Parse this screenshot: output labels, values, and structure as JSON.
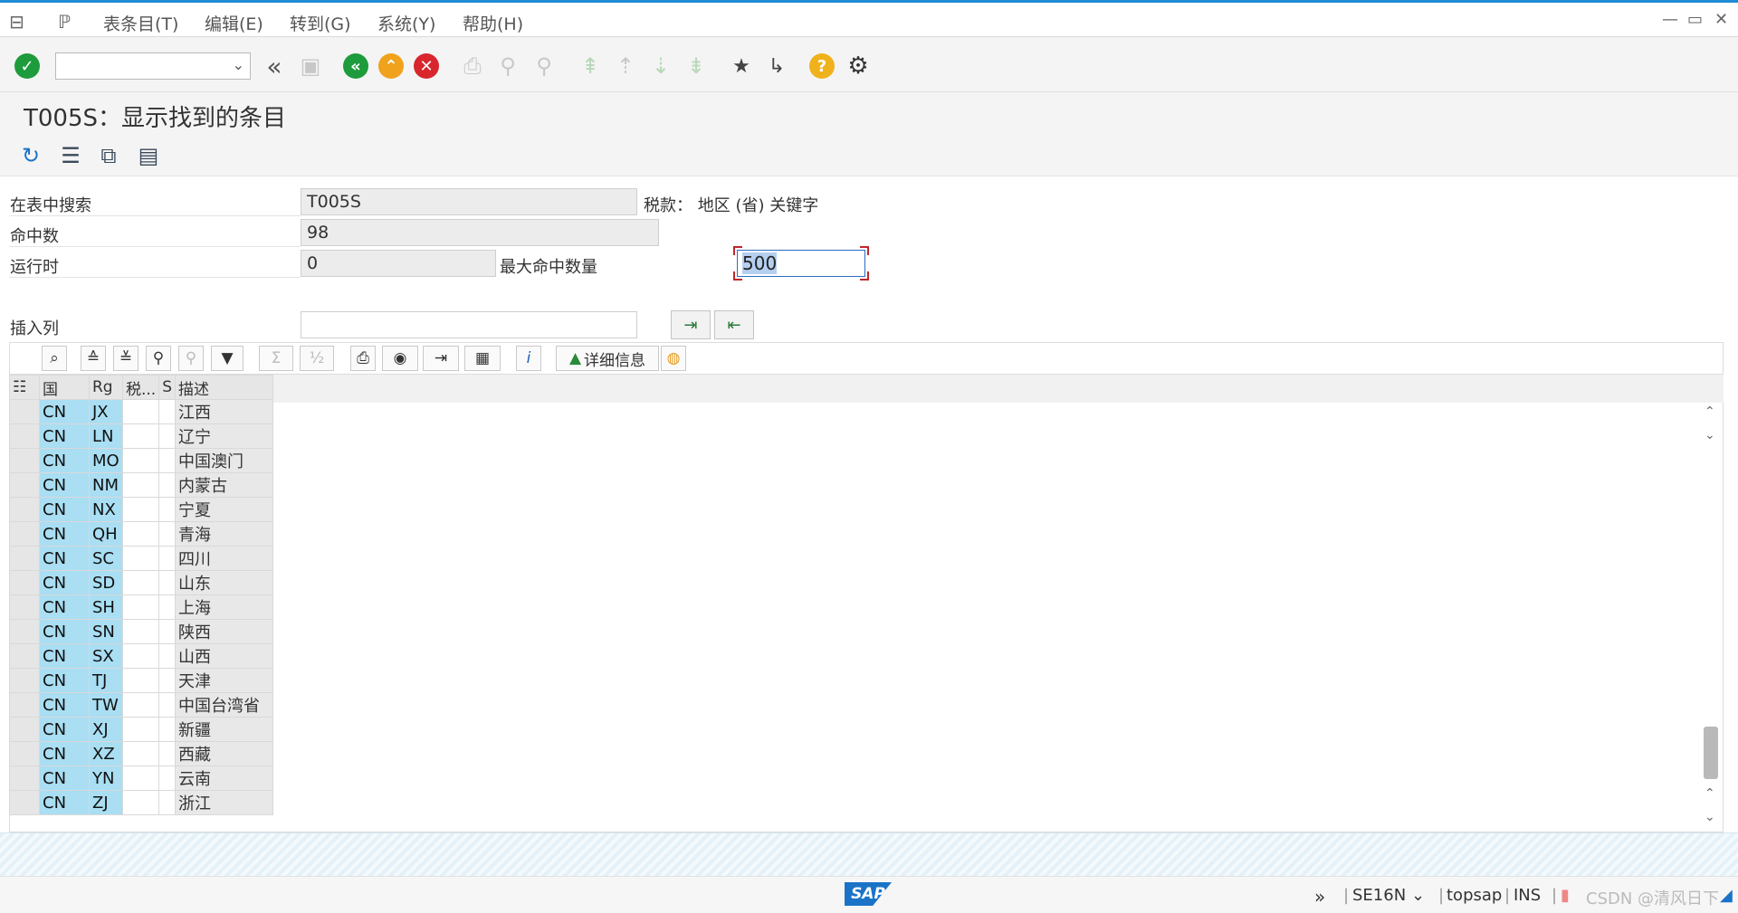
{
  "menu": [
    "表条目(T)",
    "编辑(E)",
    "转到(G)",
    "系统(Y)",
    "帮助(H)"
  ],
  "window_controls": [
    "—",
    "▭",
    "✕"
  ],
  "toolbar": {
    "command_field_value": "",
    "icons": [
      "enter-icon",
      "back-icon",
      "exit-icon",
      "cancel-icon",
      "print-icon",
      "find-icon",
      "find-next-icon",
      "first-page-icon",
      "previous-page-icon",
      "next-page-icon",
      "last-page-icon",
      "new-session-icon",
      "shortcut-icon",
      "help-icon",
      "settings-icon"
    ]
  },
  "title": "T005S：显示找到的条目",
  "app_toolbar_icons": [
    "refresh-icon",
    "table-selection-icon",
    "settings-puzzle-icon",
    "document-icon"
  ],
  "search": {
    "table_label": "在表中搜索",
    "table_value": "T005S",
    "table_desc": "税款：  地区 (省) 关键字",
    "hits_label": "命中数",
    "hits_value": "98",
    "runtime_label": "运行时",
    "runtime_value": "0",
    "max_hits_label": "最大命中数量",
    "max_hits_value": "500",
    "insert_column_label": "插入列",
    "insert_column_value": ""
  },
  "alv": {
    "details_label": "详细信息",
    "columns": [
      "国",
      "Rg",
      "税...",
      "S",
      "描述"
    ],
    "rows": [
      {
        "country": "CN",
        "region": "JX",
        "tax": "",
        "s": "",
        "desc": "江西"
      },
      {
        "country": "CN",
        "region": "LN",
        "tax": "",
        "s": "",
        "desc": "辽宁"
      },
      {
        "country": "CN",
        "region": "MO",
        "tax": "",
        "s": "",
        "desc": "中国澳门"
      },
      {
        "country": "CN",
        "region": "NM",
        "tax": "",
        "s": "",
        "desc": "内蒙古"
      },
      {
        "country": "CN",
        "region": "NX",
        "tax": "",
        "s": "",
        "desc": "宁夏"
      },
      {
        "country": "CN",
        "region": "QH",
        "tax": "",
        "s": "",
        "desc": "青海"
      },
      {
        "country": "CN",
        "region": "SC",
        "tax": "",
        "s": "",
        "desc": "四川"
      },
      {
        "country": "CN",
        "region": "SD",
        "tax": "",
        "s": "",
        "desc": "山东"
      },
      {
        "country": "CN",
        "region": "SH",
        "tax": "",
        "s": "",
        "desc": "上海"
      },
      {
        "country": "CN",
        "region": "SN",
        "tax": "",
        "s": "",
        "desc": "陕西"
      },
      {
        "country": "CN",
        "region": "SX",
        "tax": "",
        "s": "",
        "desc": "山西"
      },
      {
        "country": "CN",
        "region": "TJ",
        "tax": "",
        "s": "",
        "desc": "天津"
      },
      {
        "country": "CN",
        "region": "TW",
        "tax": "",
        "s": "",
        "desc": "中国台湾省"
      },
      {
        "country": "CN",
        "region": "XJ",
        "tax": "",
        "s": "",
        "desc": "新疆"
      },
      {
        "country": "CN",
        "region": "XZ",
        "tax": "",
        "s": "",
        "desc": "西藏"
      },
      {
        "country": "CN",
        "region": "YN",
        "tax": "",
        "s": "",
        "desc": "云南"
      },
      {
        "country": "CN",
        "region": "ZJ",
        "tax": "",
        "s": "",
        "desc": "浙江"
      }
    ]
  },
  "status": {
    "logo": "SAP",
    "transaction": "SE16N",
    "server": "topsap",
    "mode": "INS",
    "watermark": "CSDN @清风日下"
  },
  "colors": {
    "key_cell": "#a9def3",
    "accent": "#1f8bd6",
    "enter_green": "#1e9b3c",
    "cancel_red": "#d9262c",
    "exit_orange": "#f0a21c"
  }
}
